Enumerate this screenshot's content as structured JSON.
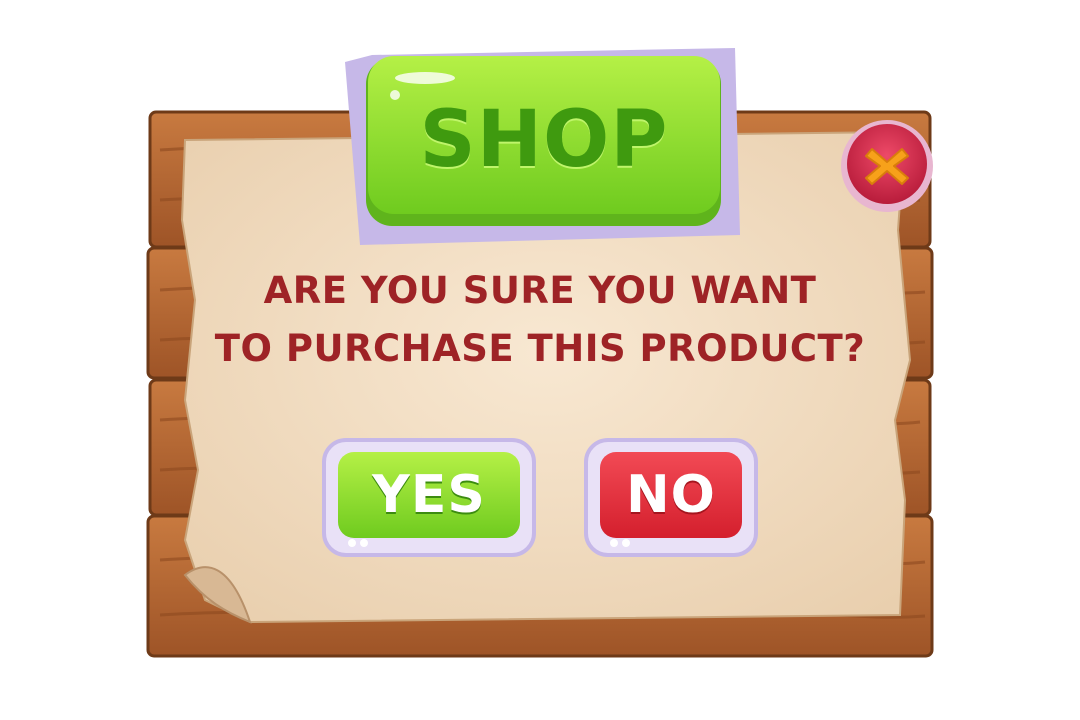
{
  "dialog": {
    "title": "SHOP",
    "question_line1": "Are you sure you want",
    "question_line2": "to purchase this product?",
    "yes_label": "YES",
    "no_label": "NO",
    "close_icon": "close-x-icon"
  },
  "colors": {
    "wood": "#b86a35",
    "parchment": "#f3dfc2",
    "title_green": "#8fdc2c",
    "question_red": "#9e2326",
    "yes_green": "#7fcf25",
    "no_red": "#e8323f",
    "close_pink": "#d9304f"
  }
}
